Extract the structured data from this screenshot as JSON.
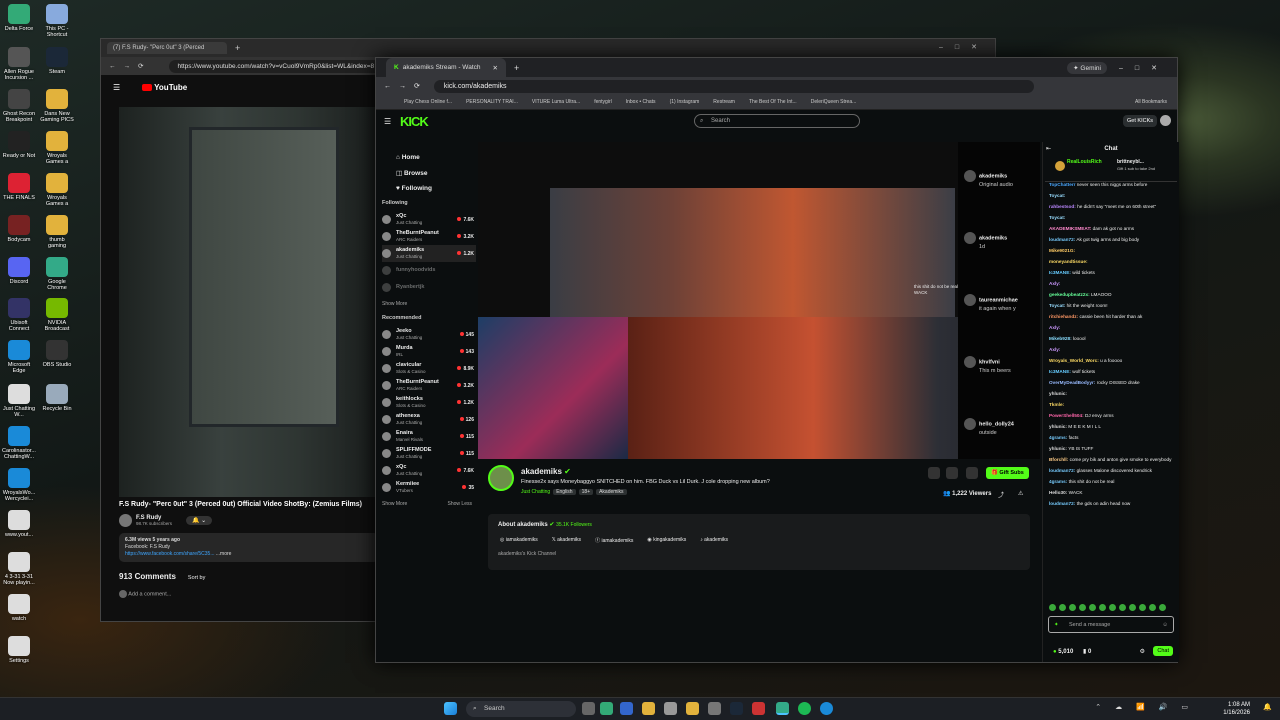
{
  "desktop": {
    "icons": [
      {
        "label": "Delta Force",
        "color": "#3a7"
      },
      {
        "label": "This PC - Shortcut",
        "color": "#8ad"
      },
      {
        "label": "Allen Rogue Incursion ...",
        "color": "#555"
      },
      {
        "label": "Steam",
        "color": "#1b2838"
      },
      {
        "label": "Ghost Recon Breakpoint",
        "color": "#444"
      },
      {
        "label": "Dans New Gaming PICS",
        "color": "#e2b23c"
      },
      {
        "label": "Ready or Not",
        "color": "#222"
      },
      {
        "label": "Wroyals Games a",
        "color": "#e2b23c"
      },
      {
        "label": "THE FINALS",
        "color": "#d23"
      },
      {
        "label": "Wroyals Games a",
        "color": "#e2b23c"
      },
      {
        "label": "Bodycam",
        "color": "#722"
      },
      {
        "label": "thumb gaming",
        "color": "#e2b23c"
      },
      {
        "label": "Discord",
        "color": "#5865f2"
      },
      {
        "label": "Google Chrome",
        "color": "#3a8"
      },
      {
        "label": "Ubisoft Connect",
        "color": "#336"
      },
      {
        "label": "NVIDIA Broadcast",
        "color": "#76b900"
      },
      {
        "label": "Microsoft Edge",
        "color": "#1a8ad8"
      },
      {
        "label": "OBS Studio",
        "color": "#333"
      },
      {
        "label": "Just Chatting W...",
        "color": "#ddd"
      },
      {
        "label": "Recycle Bin",
        "color": "#9ab"
      },
      {
        "label": "Carolinastor... ChattingW...",
        "color": "#1a8ad8"
      },
      {
        "label": "WroyalsWo... Wercyclei...",
        "color": "#1a8ad8"
      },
      {
        "label": "www.yout...",
        "color": "#ddd"
      },
      {
        "label": "4 3-31 3-31 Now playin...",
        "color": "#ddd"
      },
      {
        "label": "watch",
        "color": "#ddd"
      },
      {
        "label": "Settings",
        "color": "#ddd"
      }
    ]
  },
  "youtube": {
    "tab_title": "(7) F.S Rudy- \"Perc 0ut\" 3 (Perced",
    "url": "https://www.youtube.com/watch?v=vCuol9VmRp0&list=WL&index=8",
    "logo": "YouTube",
    "video_title": "F.S Rudy- \"Perc 0ut\" 3 (Perced 0ut) Official Video ShotBy: (Zemius Films)",
    "channel": "F.S Rudy",
    "subscribers": "98.7K subscribers",
    "views": "6.3M views  5 years ago",
    "desc1": "Facebook: F.S Rudy",
    "desc2": "https://www.facebook.com/share/5C35...",
    "more": "...more",
    "comments": "913 Comments",
    "sort": "Sort by",
    "add_comment": "Add a comment..."
  },
  "kick": {
    "tab_title": "akademiks Stream - Watch",
    "url": "kick.com/akademiks",
    "gemini": "Gemini",
    "bookmarks": [
      "Play Chess Online f...",
      "PERSONALITY TRAI...",
      "VITURE Luma Ultra...",
      "fentygirl",
      "Inbox • Chats",
      "(1) Instagram",
      "Restream",
      "The Best Of The Int...",
      "DeleriQueen Strea...",
      "All Bookmarks"
    ],
    "logo": "KICK",
    "search_placeholder": "Search",
    "get_kicks": "Get KICKs",
    "nav": {
      "home": "Home",
      "browse": "Browse",
      "following": "Following"
    },
    "following_title": "Following",
    "following": [
      {
        "name": "xQc",
        "cat": "Just Chatting",
        "viewers": "7.6K"
      },
      {
        "name": "TheBurntPeanut",
        "cat": "ARC Raiders",
        "viewers": "3.2K"
      },
      {
        "name": "akademiks",
        "cat": "Just Chatting",
        "viewers": "1.2K"
      },
      {
        "name": "funnyhoodvids",
        "cat": "",
        "viewers": ""
      },
      {
        "name": "Ryanbertjk",
        "cat": "",
        "viewers": ""
      }
    ],
    "show_more": "Show More",
    "recommended_title": "Recommended",
    "recommended": [
      {
        "name": "Jeeko",
        "cat": "Just Chatting",
        "viewers": "145"
      },
      {
        "name": "Murda",
        "cat": "IRL",
        "viewers": "143"
      },
      {
        "name": "clavicular",
        "cat": "Slots & Casino",
        "viewers": "8.9K"
      },
      {
        "name": "TheBurntPeanut",
        "cat": "ARC Raiders",
        "viewers": "3.2K"
      },
      {
        "name": "keithlocks",
        "cat": "Slots & Casino",
        "viewers": "1.2K"
      },
      {
        "name": "athenexa",
        "cat": "Just Chatting",
        "viewers": "126"
      },
      {
        "name": "Enaira",
        "cat": "Marvel Rivals",
        "viewers": "115"
      },
      {
        "name": "SPLIFFMODE",
        "cat": "Just Chatting",
        "viewers": "115"
      },
      {
        "name": "xQc",
        "cat": "Just Chatting",
        "viewers": "7.6K"
      },
      {
        "name": "Kermiiee",
        "cat": "VTubers",
        "viewers": "35"
      }
    ],
    "show_less": "Show Less",
    "streamer": "akademiks",
    "stream_title": "Finesse2x says Moneybaggyo SNITCHED on him. FBG Duck vs Lil Durk. J cole dropping new album?",
    "category": "Just Chatting",
    "tags": [
      "English",
      "18+",
      "Akademiks"
    ],
    "gift_subs": "Gift Subs",
    "viewers": "1,222 Viewers",
    "about_title": "About akademiks",
    "followers": "35.1K Followers",
    "socials": [
      "iamakademiks",
      "akademiks",
      "iamakademiks",
      "kingakademiks",
      "akademiks"
    ],
    "about_text": "akademiks's Kick Channel",
    "ig_overlay": [
      {
        "user": "akademiks",
        "text": "Original audio"
      },
      {
        "user": "akademiks",
        "text": "1d"
      },
      {
        "user": "taureanmichae",
        "text": "it again when y"
      },
      {
        "user": "khvlfvni",
        "text": "This m beers"
      },
      {
        "user": "hello_dolly24",
        "text": "outside"
      }
    ],
    "overlay_chat": [
      "this shit do not be real",
      "WACK"
    ]
  },
  "chat": {
    "title": "Chat",
    "pinned": {
      "user": "RealLouisRich",
      "user2": "brittneybl...",
      "note": "Gift 1 sub to take 2nd"
    },
    "messages": [
      {
        "u": "TopChatterr",
        "c": "#4aa8ff",
        "t": "never seen this niggs arms before"
      },
      {
        "u": "Toycat:",
        "c": "#9df",
        "t": ""
      },
      {
        "u": "rahbestsod:",
        "c": "#b8f",
        "t": "he didn't say \"meet me on 60th street\""
      },
      {
        "u": "Toycat:",
        "c": "#9df",
        "t": ""
      },
      {
        "u": "AKADEMIKSMEAT:",
        "c": "#f8c",
        "t": "dam ak got no arms"
      },
      {
        "u": "loudman72:",
        "c": "#7cf",
        "t": "Ak got twig arms and big body"
      },
      {
        "u": "Mike9021G:",
        "c": "#fc6",
        "t": ""
      },
      {
        "u": "moneyandtissue:",
        "c": "#fd6",
        "t": ""
      },
      {
        "u": "Ic3MANE:",
        "c": "#6cf",
        "t": "wild tickets"
      },
      {
        "u": "Axly:",
        "c": "#c9f",
        "t": ""
      },
      {
        "u": "geekedupbeatz2x:",
        "c": "#6f9",
        "t": "LMAOOO"
      },
      {
        "u": "Toycat:",
        "c": "#9df",
        "t": "hit the weight room!"
      },
      {
        "u": "ritchiehandz:",
        "c": "#f96",
        "t": "cassie been hit harder than ak"
      },
      {
        "u": "Axly:",
        "c": "#c9f",
        "t": ""
      },
      {
        "u": "Mikeb928:",
        "c": "#8df",
        "t": "looool"
      },
      {
        "u": "Axly:",
        "c": "#c9f",
        "t": ""
      },
      {
        "u": "Wroyals_World_Worc:",
        "c": "#fd6",
        "t": "u a fooooo"
      },
      {
        "u": "Ic3MANE:",
        "c": "#6cf",
        "t": "wolf tickets"
      },
      {
        "u": "OverMyDeadBodyyr:",
        "c": "#9bf",
        "t": "rocky DISSED drake"
      },
      {
        "u": "yhlunic:",
        "c": "#ddd",
        "t": ""
      },
      {
        "u": "Tkmle:",
        "c": "#fd6",
        "t": ""
      },
      {
        "u": "PowerShell504:",
        "c": "#f6a",
        "t": "DJ envy arms"
      },
      {
        "u": "yhlunic:",
        "c": "#ddd",
        "t": "M E E K M I L L"
      },
      {
        "u": "4grams:",
        "c": "#7cf",
        "t": "facts"
      },
      {
        "u": "yhlunic:",
        "c": "#ddd",
        "t": "YB IS TUFF"
      },
      {
        "u": "Bforchll:",
        "c": "#fc8",
        "t": "come pry bik and anton give smoke to everybody"
      },
      {
        "u": "loudman72:",
        "c": "#7cf",
        "t": "glasses Malone discovered kendrick"
      },
      {
        "u": "4grams:",
        "c": "#7cf",
        "t": "this shit do not be real"
      },
      {
        "u": "Hello30:",
        "c": "#ddd",
        "t": "WACK"
      },
      {
        "u": "loudman72:",
        "c": "#7cf",
        "t": "the gds on adin head now"
      }
    ],
    "send_placeholder": "Send a message",
    "points": "5,010",
    "count": "0",
    "chat_button": "Chat"
  },
  "taskbar": {
    "search": "Search",
    "time": "1:08 AM",
    "date": "1/16/2026"
  }
}
